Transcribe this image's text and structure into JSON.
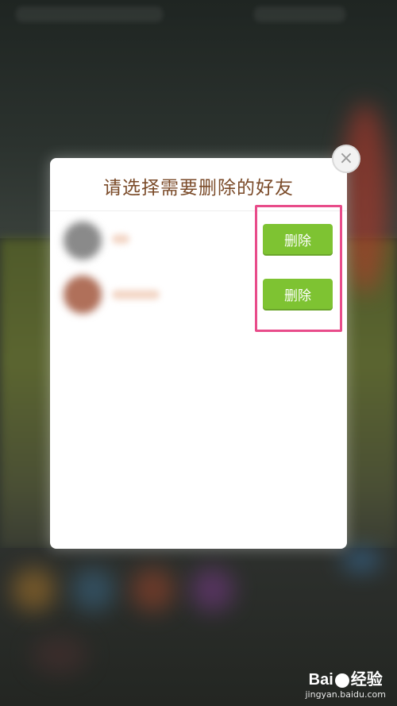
{
  "dialog": {
    "title": "请选择需要删除的好友",
    "close_label": "×"
  },
  "friends": [
    {
      "delete_label": "删除"
    },
    {
      "delete_label": "删除"
    }
  ],
  "colors": {
    "title": "#7a4a28",
    "delete_button": "#7ec332",
    "highlight": "#e84c8a"
  },
  "watermark": {
    "logo": "Bai",
    "logo_suffix": "经验",
    "url": "jingyan.baidu.com"
  }
}
